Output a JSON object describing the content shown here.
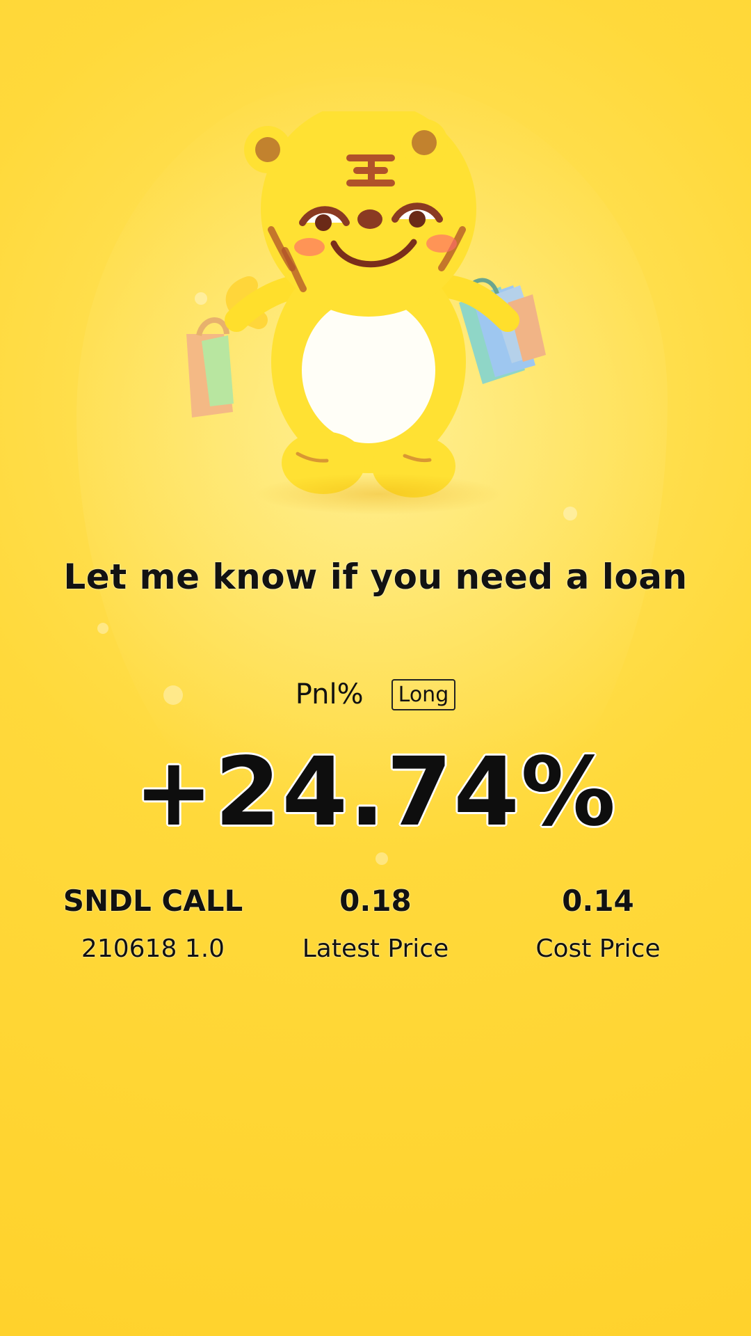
{
  "screen": {
    "background_colors": [
      "#ffe76a",
      "#ffd93b",
      "#ffd22c"
    ],
    "mascot": {
      "name": "tiger-mascot-icon",
      "description_colors": {
        "fur": "#ffe333",
        "belly": "#ffffff",
        "stripes": "#b0522a"
      }
    }
  },
  "message": {
    "text": "Let me know if you need a loan"
  },
  "pnl": {
    "label": "Pnl%",
    "badge": "Long",
    "value": "+24.74%"
  },
  "stats": {
    "instrument": {
      "name": "SNDL CALL",
      "detail": "210618 1.0"
    },
    "latest": {
      "value": "0.18",
      "label": "Latest Price"
    },
    "cost": {
      "value": "0.14",
      "label": "Cost Price"
    }
  }
}
